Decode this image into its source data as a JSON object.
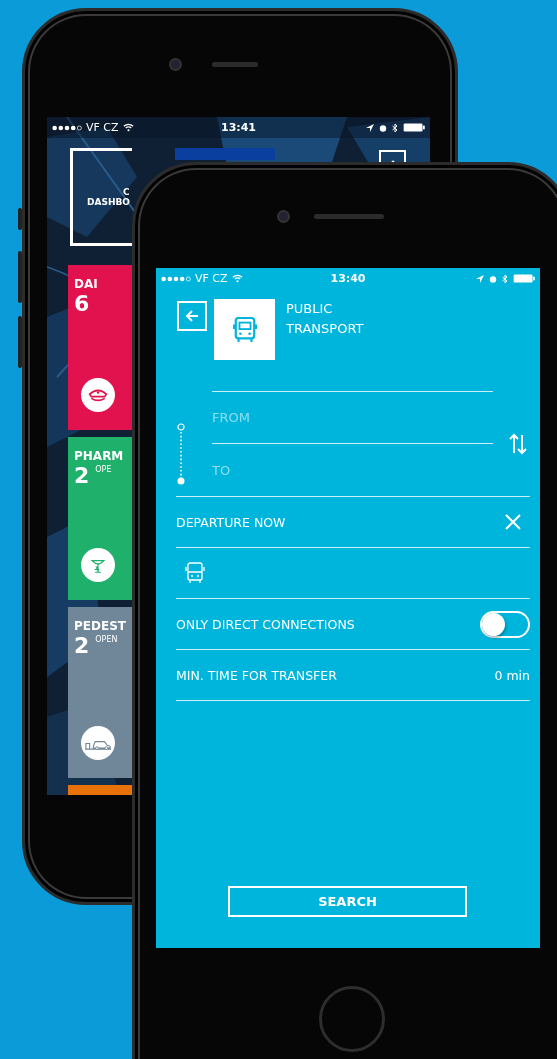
{
  "back_screen": {
    "status_bar": {
      "carrier": "VF CZ",
      "time": "13:41"
    },
    "dashboard_tile": {
      "lines": [
        "C",
        "DASHBO"
      ]
    },
    "tiles": [
      {
        "kind": "cap",
        "title": "DAI",
        "count": "6",
        "color": "#e2124f"
      },
      {
        "kind": "pharmacy",
        "title": "PHARM",
        "count": "2",
        "note": "OPE",
        "color": "#1fb06c"
      },
      {
        "kind": "parking",
        "title": "PEDEST",
        "count": "2",
        "note": "OPEN",
        "color": "#6f8799"
      },
      {
        "kind": "blank",
        "color": "#e8710a"
      }
    ]
  },
  "front_screen": {
    "status_bar": {
      "carrier": "VF CZ",
      "time": "13:40"
    },
    "title": "PUBLIC TRANSPORT",
    "route": {
      "from": {
        "placeholder": "FROM"
      },
      "to": {
        "placeholder": "TO"
      }
    },
    "departure": {
      "label": "DEPARTURE NOW"
    },
    "direct_connections": {
      "label": "ONLY DIRECT CONNECTIONS",
      "on": false
    },
    "transfer": {
      "label": "MIN. TIME FOR TRANSFER",
      "value": "0 min"
    },
    "search_button": "SEARCH"
  }
}
